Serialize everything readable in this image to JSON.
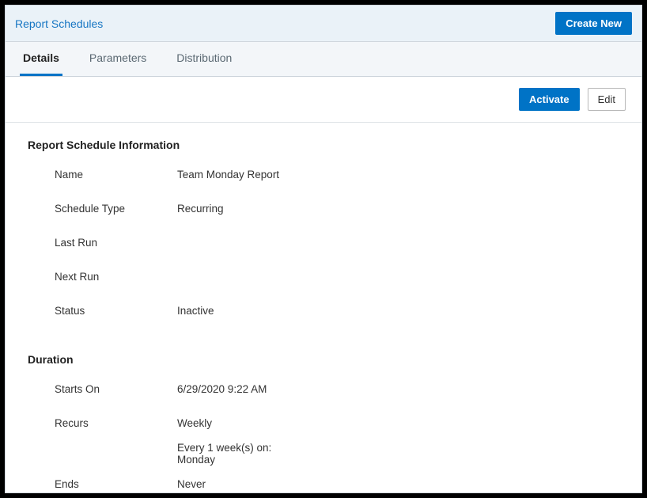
{
  "header": {
    "title": "Report Schedules",
    "createButton": "Create New"
  },
  "tabs": [
    {
      "label": "Details"
    },
    {
      "label": "Parameters"
    },
    {
      "label": "Distribution"
    }
  ],
  "actions": {
    "activate": "Activate",
    "edit": "Edit"
  },
  "sections": {
    "info": {
      "title": "Report Schedule Information",
      "fields": {
        "nameLabel": "Name",
        "nameValue": "Team Monday Report",
        "scheduleTypeLabel": "Schedule Type",
        "scheduleTypeValue": "Recurring",
        "lastRunLabel": "Last Run",
        "lastRunValue": "",
        "nextRunLabel": "Next Run",
        "nextRunValue": "",
        "statusLabel": "Status",
        "statusValue": "Inactive"
      }
    },
    "duration": {
      "title": "Duration",
      "fields": {
        "startsOnLabel": "Starts On",
        "startsOnValue": "6/29/2020  9:22 AM",
        "recursLabel": "Recurs",
        "recursValue": "Weekly",
        "recursDetail1": "Every  1 week(s) on:",
        "recursDetail2": "Monday",
        "endsLabel": "Ends",
        "endsValue": "Never"
      }
    }
  }
}
